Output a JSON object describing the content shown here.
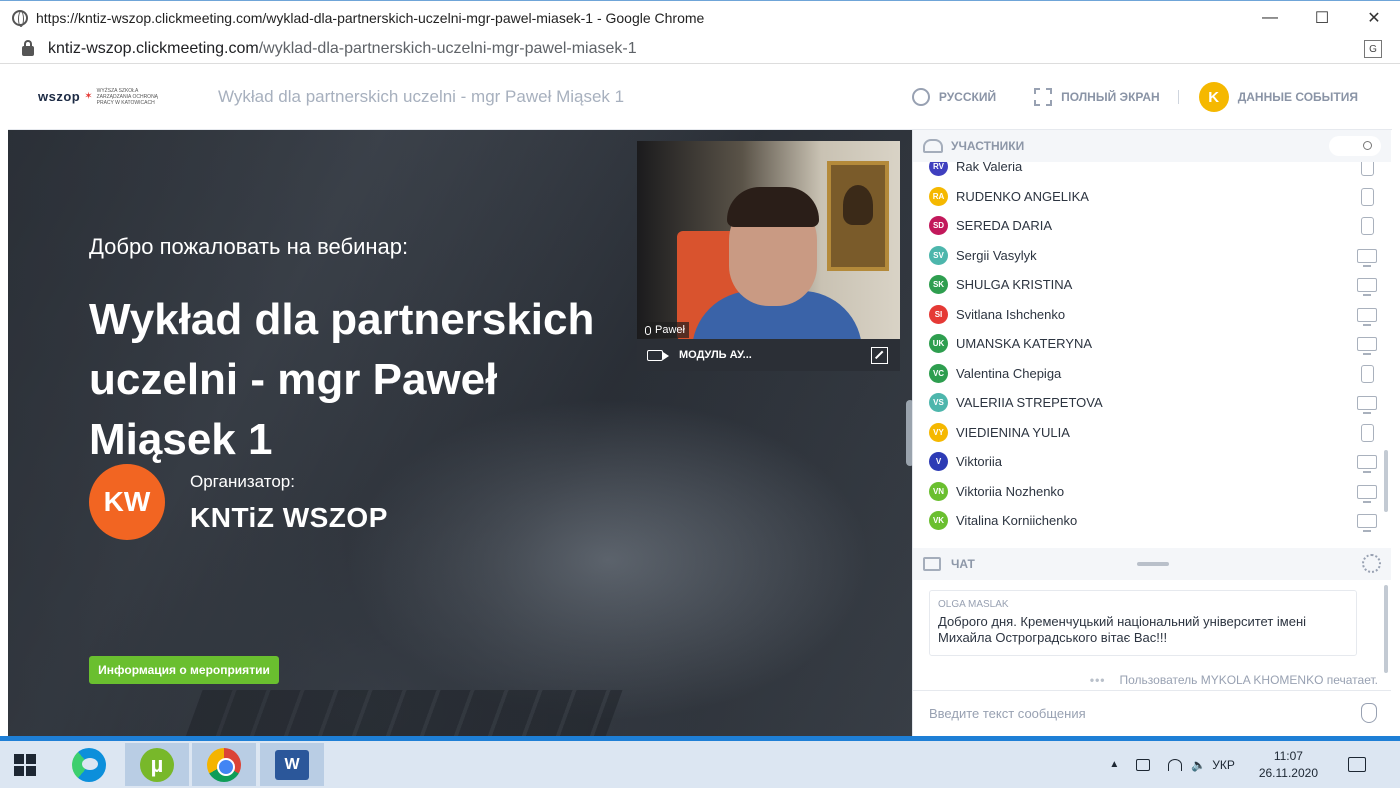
{
  "browser": {
    "window_title": "https://kntiz-wszop.clickmeeting.com/wyklad-dla-partnerskich-uczelni-mgr-pawel-miasek-1 - Google Chrome",
    "url_host": "kntiz-wszop.clickmeeting.com",
    "url_path": "/wyklad-dla-partnerskich-uczelni-mgr-pawel-miasek-1",
    "minimize": "—",
    "maximize": "☐",
    "close": "✕",
    "translate_glyph": "G"
  },
  "header": {
    "logo_text": "wszop",
    "logo_sub": "WYŻSZA SZKOŁA ZARZĄDZANIA OCHRONĄ PRACY W KATOWICACH",
    "event_title": "Wykład dla partnerskich uczelni - mgr Paweł Miąsek 1",
    "language_label": "РУССКИЙ",
    "fullscreen_label": "ПОЛНЫЙ ЭКРАН",
    "avatar_initial": "K",
    "event_data_label": "ДАННЫЕ СОБЫТИЯ"
  },
  "stage": {
    "welcome": "Добро пожаловать на вебинар:",
    "title": "Wykład dla partnerskich uczelni - mgr Paweł Miąsek 1",
    "organizer_initials": "KW",
    "organizer_label": "Организатор:",
    "organizer_name": "KNTiZ WSZOP",
    "info_button": "Информация о мероприятии"
  },
  "video": {
    "presenter_name": "Paweł",
    "module_label": "МОДУЛЬ АУ..."
  },
  "participants": {
    "header": "УЧАСТНИКИ",
    "items": [
      {
        "initials": "RV",
        "name": "Rak Valeria",
        "color": "#3f3fbf",
        "device": "web"
      },
      {
        "initials": "RA",
        "name": "RUDENKO ANGELIKA",
        "color": "#f5b800",
        "device": "web"
      },
      {
        "initials": "SD",
        "name": "SEREDA DARIA",
        "color": "#c2185b",
        "device": "web"
      },
      {
        "initials": "SV",
        "name": "Sergii Vasylyk",
        "color": "#4db6ac",
        "device": "desktop"
      },
      {
        "initials": "SK",
        "name": "SHULGA KRISTINA",
        "color": "#2e9e4f",
        "device": "desktop"
      },
      {
        "initials": "SI",
        "name": "Svitlana Ishchenko",
        "color": "#e53935",
        "device": "desktop"
      },
      {
        "initials": "UK",
        "name": "UMANSKA KATERYNA",
        "color": "#2e9e4f",
        "device": "desktop"
      },
      {
        "initials": "VC",
        "name": "Valentina Chepiga",
        "color": "#2e9e4f",
        "device": "web"
      },
      {
        "initials": "VS",
        "name": "VALERIIA STREPETOVA",
        "color": "#4db6ac",
        "device": "desktop"
      },
      {
        "initials": "VY",
        "name": "VIEDIENINA YULIA",
        "color": "#f5b800",
        "device": "app"
      },
      {
        "initials": "V",
        "name": "Viktoriia",
        "color": "#2d3bb5",
        "device": "desktop"
      },
      {
        "initials": "VN",
        "name": "Viktoriia Nozhenko",
        "color": "#6abf2f",
        "device": "desktop"
      },
      {
        "initials": "VK",
        "name": "Vitalina Korniichenko",
        "color": "#6abf2f",
        "device": "desktop"
      }
    ]
  },
  "chat": {
    "header": "ЧАТ",
    "message_author": "OLGA MASLAK",
    "message_text": "Доброго дня. Кременчуцький національний університет імені Михайла Остроградського вітає Вас!!!",
    "typing_dots": "•••",
    "typing_text": "Пользователь MYKOLA KHOMENKO печатает.",
    "input_placeholder": "Введите текст сообщения"
  },
  "taskbar": {
    "utorrent_glyph": "µ",
    "word_glyph": "W",
    "tray_caret": "▲",
    "volume_glyph": "🔈",
    "language": "УКР",
    "time": "11:07",
    "date": "26.11.2020"
  }
}
